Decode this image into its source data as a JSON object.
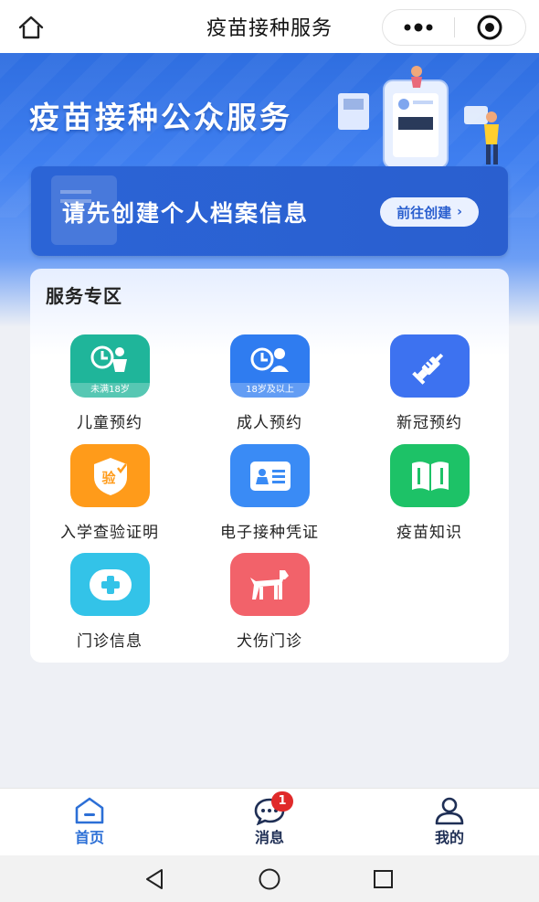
{
  "topbar": {
    "title": "疫苗接种服务",
    "home_icon": "home-icon",
    "more_icon": "more-dots-icon",
    "target_icon": "target-icon"
  },
  "banner": {
    "headline": "疫苗接种公众服务",
    "profile_prompt": "请先创建个人档案信息",
    "create_button": "前往创建"
  },
  "services": {
    "title": "服务专区",
    "items": [
      {
        "label": "儿童预约",
        "badge": "未满18岁",
        "icon": "child-icon",
        "color": "#1fb59a"
      },
      {
        "label": "成人预约",
        "badge": "18岁及以上",
        "icon": "adult-icon",
        "color": "#2f7cf0"
      },
      {
        "label": "新冠预约",
        "badge": "",
        "icon": "syringe-icon",
        "color": "#3d72f0"
      },
      {
        "label": "入学查验证明",
        "badge": "",
        "icon": "shield-check-icon",
        "color": "#ff9b1a"
      },
      {
        "label": "电子接种凭证",
        "badge": "",
        "icon": "id-card-icon",
        "color": "#3a8bf5"
      },
      {
        "label": "疫苗知识",
        "badge": "",
        "icon": "book-icon",
        "color": "#1dc267"
      },
      {
        "label": "门诊信息",
        "badge": "",
        "icon": "medical-cross-icon",
        "color": "#33c3e8"
      },
      {
        "label": "犬伤门诊",
        "badge": "",
        "icon": "dog-icon",
        "color": "#f2626a"
      }
    ],
    "shield_text": "验"
  },
  "tabbar": {
    "tabs": [
      {
        "label": "首页",
        "icon": "home-tab-icon",
        "active": true
      },
      {
        "label": "消息",
        "icon": "message-icon",
        "badge": "1"
      },
      {
        "label": "我的",
        "icon": "user-icon"
      }
    ],
    "active_color": "#2c6fd6",
    "inactive_color": "#1f2f55"
  },
  "android_nav": {
    "back": "back-triangle-icon",
    "home": "home-circle-icon",
    "recents": "recents-square-icon"
  }
}
